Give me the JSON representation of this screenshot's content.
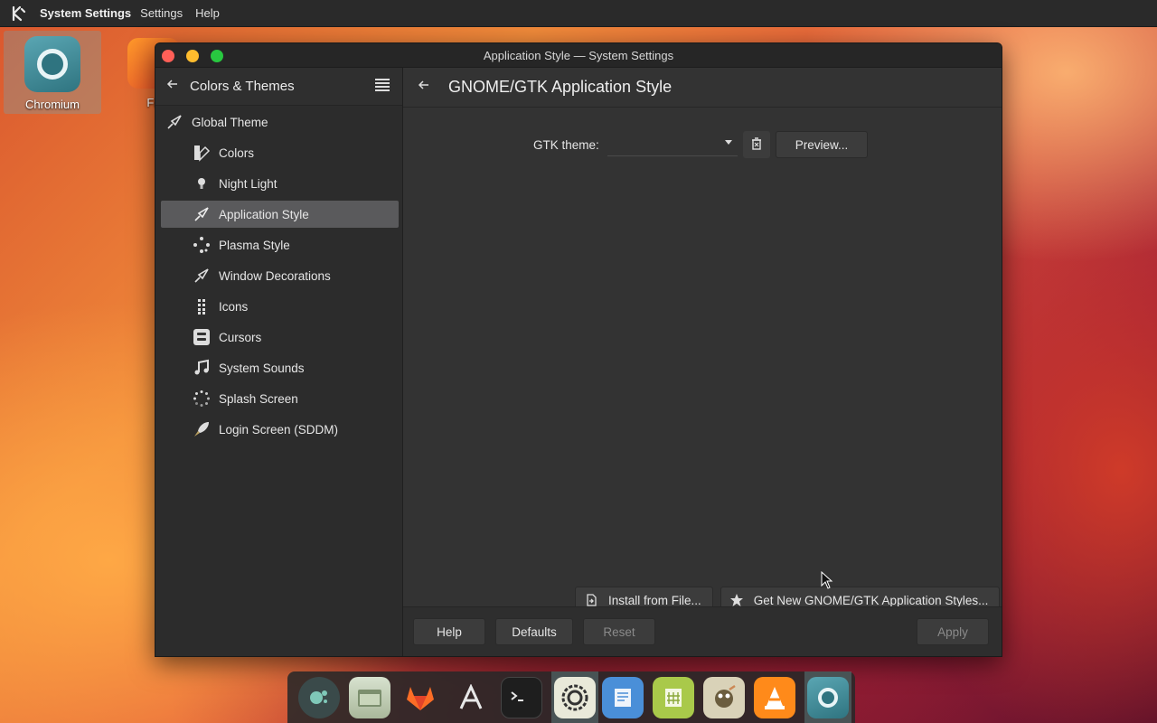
{
  "topbar": {
    "app_name": "System Settings",
    "menu_settings": "Settings",
    "menu_help": "Help"
  },
  "desktop": {
    "chromium_label": "Chromium",
    "firefox_label": "Fir"
  },
  "window": {
    "title": "Application Style — System Settings"
  },
  "sidebar": {
    "header_title": "Colors & Themes",
    "items": [
      {
        "label": "Global Theme",
        "icon": "paintbrush-icon"
      },
      {
        "label": "Colors",
        "icon": "color-swatch-icon"
      },
      {
        "label": "Night Light",
        "icon": "lightbulb-icon"
      },
      {
        "label": "Application Style",
        "icon": "brush-icon",
        "active": true
      },
      {
        "label": "Plasma Style",
        "icon": "dots-circle-icon"
      },
      {
        "label": "Window Decorations",
        "icon": "brush-icon"
      },
      {
        "label": "Icons",
        "icon": "grid-icon"
      },
      {
        "label": "Cursors",
        "icon": "cursor-icon"
      },
      {
        "label": "System Sounds",
        "icon": "music-note-icon"
      },
      {
        "label": "Splash Screen",
        "icon": "spinner-icon"
      },
      {
        "label": "Login Screen (SDDM)",
        "icon": "rocket-icon"
      }
    ]
  },
  "content": {
    "page_title": "GNOME/GTK Application Style",
    "gtk_theme_label": "GTK theme:",
    "gtk_theme_value": "",
    "preview_label": "Preview...",
    "install_label": "Install from File...",
    "get_new_label": "Get New GNOME/GTK Application Styles..."
  },
  "footer": {
    "help": "Help",
    "defaults": "Defaults",
    "reset": "Reset",
    "apply": "Apply"
  },
  "dock": {
    "items": [
      "discover-icon",
      "files-icon",
      "gitlab-icon",
      "font-store-icon",
      "terminal-icon",
      "settings-icon",
      "writer-icon",
      "calc-icon",
      "gimp-icon",
      "vlc-icon",
      "chromium-icon"
    ]
  },
  "colors": {
    "accent": "#5a5a5c",
    "window_bg": "#2f2f2f",
    "content_bg": "#333333"
  }
}
